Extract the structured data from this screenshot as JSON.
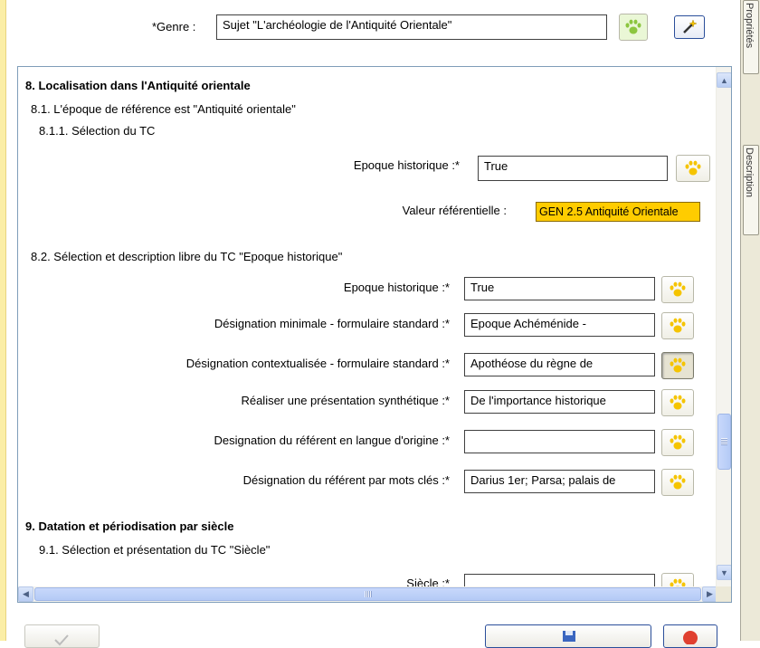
{
  "genre": {
    "label": "*Genre :",
    "value": "Sujet \"L'archéologie de l'Antiquité Orientale\""
  },
  "side_tabs": [
    "Propriétés",
    "Description"
  ],
  "sections": {
    "s8": {
      "title": "8. Localisation dans l'Antiquité orientale",
      "s81": "8.1. L'époque de référence est \"Antiquité orientale\"",
      "s811": "8.1.1. Sélection du TC",
      "epoque_label": "Epoque historique :*",
      "epoque_value": "True",
      "ref_label": "Valeur référentielle :",
      "ref_value": "GEN 2.5 Antiquité Orientale",
      "s82": "8.2. Sélection et description libre du TC \"Epoque historique\"",
      "fields": [
        {
          "label": "Epoque historique :*",
          "value": "True"
        },
        {
          "label": "Désignation minimale - formulaire standard :*",
          "value": "Epoque Achéménide -"
        },
        {
          "label": "Désignation contextualisée - formulaire standard :*",
          "value": "Apothéose du règne de"
        },
        {
          "label": "Réaliser une présentation synthétique :*",
          "value": "De l'importance historique"
        },
        {
          "label": "Designation du référent en langue d'origine :*",
          "value": ""
        },
        {
          "label": "Désignation du référent par mots clés :*",
          "value": "Darius 1er; Parsa; palais de"
        }
      ]
    },
    "s9": {
      "title": "9. Datation et périodisation par siècle",
      "s91": "9.1. Sélection et présentation du TC \"Siècle\"",
      "siecle_label": "Siècle :*"
    }
  },
  "icons": {
    "paw": "paw-icon",
    "wand": "magic-wand-icon",
    "scroll_up": "scroll-up-icon",
    "scroll_down": "scroll-down-icon",
    "scroll_left": "scroll-left-icon",
    "scroll_right": "scroll-right-icon"
  },
  "colors": {
    "referential_bg": "#ffcc00",
    "paw": "#f5c400",
    "scrollbar": "#c1d3fb"
  }
}
